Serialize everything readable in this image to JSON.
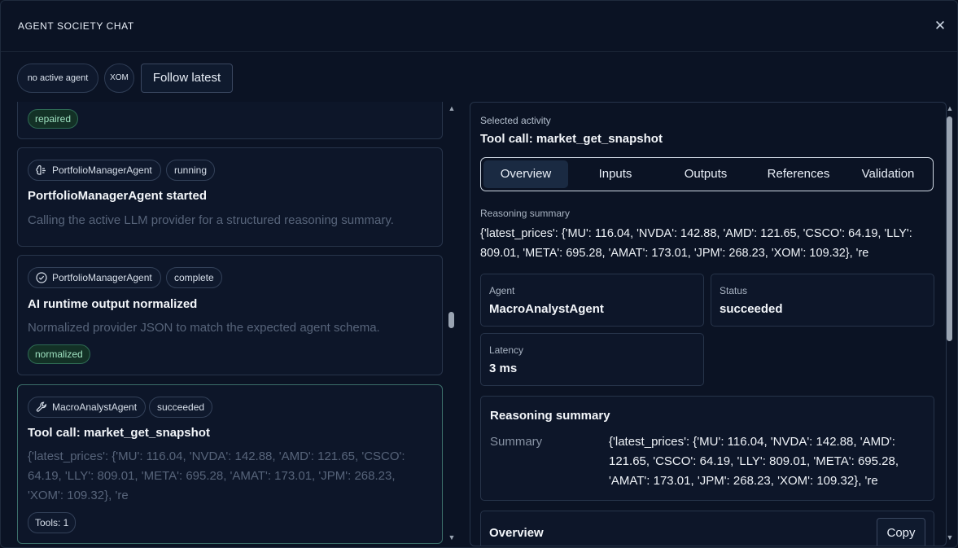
{
  "window": {
    "title": "AGENT SOCIETY CHAT",
    "close_label": "✕"
  },
  "toolbar": {
    "agent_chip": "no active agent",
    "symbol_chip": "XOM",
    "follow_button": "Follow latest"
  },
  "feed": {
    "cards": [
      {
        "status_chip": "repaired"
      },
      {
        "agent": "PortfolioManagerAgent",
        "agent_icon": "brain-icon",
        "state": "running",
        "title": "PortfolioManagerAgent started",
        "description": "Calling the active LLM provider for a structured reasoning summary."
      },
      {
        "agent": "PortfolioManagerAgent",
        "agent_icon": "check-circle-icon",
        "state": "complete",
        "title": "AI runtime output normalized",
        "description": "Normalized provider JSON to match the expected agent schema.",
        "status_chip": "normalized"
      },
      {
        "agent": "MacroAnalystAgent",
        "agent_icon": "wrench-icon",
        "state": "succeeded",
        "title": "Tool call: market_get_snapshot",
        "description": "{'latest_prices': {'MU': 116.04, 'NVDA': 142.88, 'AMD': 121.65, 'CSCO': 64.19, 'LLY': 809.01, 'META': 695.28, 'AMAT': 173.01, 'JPM': 268.23, 'XOM': 109.32}, 're",
        "tools_chip": "Tools: 1"
      }
    ]
  },
  "detail": {
    "selected_label": "Selected activity",
    "selected_title": "Tool call: market_get_snapshot",
    "tabs": [
      "Overview",
      "Inputs",
      "Outputs",
      "References",
      "Validation"
    ],
    "active_tab": "Overview",
    "reasoning_label": "Reasoning summary",
    "reasoning_text": "{'latest_prices': {'MU': 116.04, 'NVDA': 142.88, 'AMD': 121.65, 'CSCO': 64.19, 'LLY': 809.01, 'META': 695.28, 'AMAT': 173.01, 'JPM': 268.23, 'XOM': 109.32}, 're",
    "agent_label": "Agent",
    "agent_value": "MacroAnalystAgent",
    "status_label": "Status",
    "status_value": "succeeded",
    "latency_label": "Latency",
    "latency_value": "3 ms",
    "reasoning_section_title": "Reasoning summary",
    "summary_key": "Summary",
    "summary_value": "{'latest_prices': {'MU': 116.04, 'NVDA': 142.88, 'AMD': 121.65, 'CSCO': 64.19, 'LLY': 809.01, 'META': 695.28, 'AMAT': 173.01, 'JPM': 268.23, 'XOM': 109.32}, 're",
    "overview_section_title": "Overview",
    "copy_button": "Copy"
  },
  "colors": {
    "background": "#0b1324",
    "accent_green": "#9fe2c1",
    "active_card_border": "#3b6e6a"
  }
}
